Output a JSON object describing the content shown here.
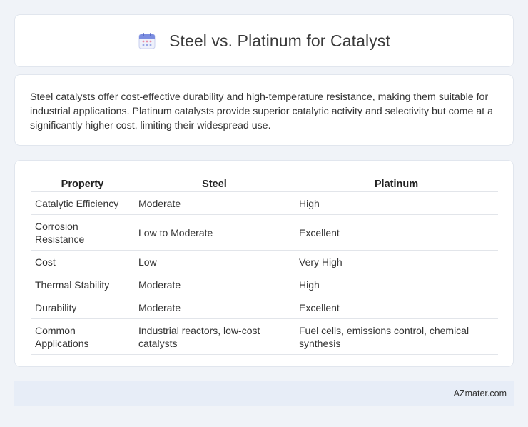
{
  "header": {
    "title": "Steel vs. Platinum for Catalyst",
    "icon": "calendar-icon"
  },
  "summary": {
    "text": "Steel catalysts offer cost-effective durability and high-temperature resistance, making them suitable for industrial applications. Platinum catalysts provide superior catalytic activity and selectivity but come at a significantly higher cost, limiting their widespread use."
  },
  "table": {
    "headers": [
      "Property",
      "Steel",
      "Platinum"
    ],
    "rows": [
      [
        "Catalytic Efficiency",
        "Moderate",
        "High"
      ],
      [
        "Corrosion Resistance",
        "Low to Moderate",
        "Excellent"
      ],
      [
        "Cost",
        "Low",
        "Very High"
      ],
      [
        "Thermal Stability",
        "Moderate",
        "High"
      ],
      [
        "Durability",
        "Moderate",
        "Excellent"
      ],
      [
        "Common Applications",
        "Industrial reactors, low-cost catalysts",
        "Fuel cells, emissions control, chemical synthesis"
      ]
    ]
  },
  "footer": {
    "brand": "AZmater.com"
  },
  "colors": {
    "page_bg": "#f0f3f8",
    "card_bg": "#ffffff",
    "footer_bg": "#e7edf7",
    "icon_accent": "#7b8de0"
  }
}
